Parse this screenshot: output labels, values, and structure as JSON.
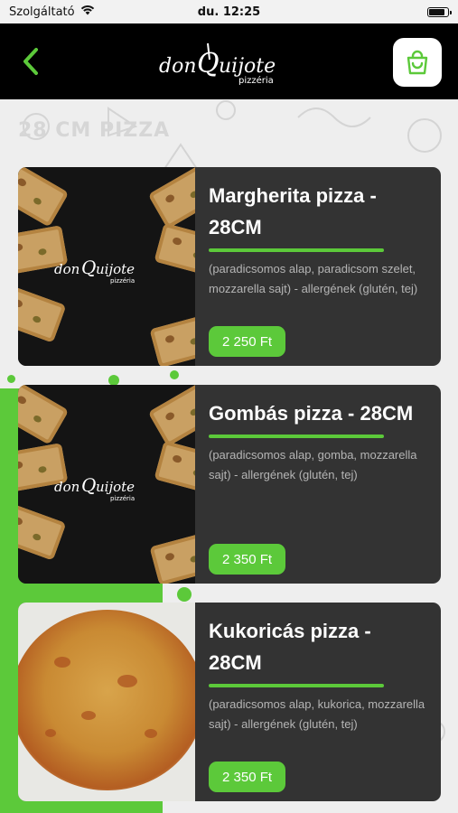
{
  "status_bar": {
    "carrier": "Szolgáltató",
    "time": "du. 12:25"
  },
  "header": {
    "logo_text": "donQuijote",
    "logo_subtext": "pizzéria"
  },
  "background": {
    "title": "28 CM PIZZA"
  },
  "colors": {
    "accent": "#5cc93a",
    "card": "#333333",
    "header": "#000000"
  },
  "products": [
    {
      "name": "Margherita pizza - 28CM",
      "description": "(paradicsomos alap, paradicsom szelet, mozzarella sajt) - allergének (glutén, tej)",
      "price": "2 250 Ft",
      "image": "donquijote-dark-pizza-photo"
    },
    {
      "name": "Gombás pizza - 28CM",
      "description": "(paradicsomos alap, gomba, mozzarella sajt) - allergének (glutén, tej)",
      "price": "2 350 Ft",
      "image": "donquijote-dark-pizza-photo"
    },
    {
      "name": "Kukoricás pizza - 28CM",
      "description": "(paradicsomos alap, kukorica, mozzarella sajt) - allergének (glutén, tej)",
      "price": "2 350 Ft",
      "image": "corn-pizza-photo"
    }
  ]
}
